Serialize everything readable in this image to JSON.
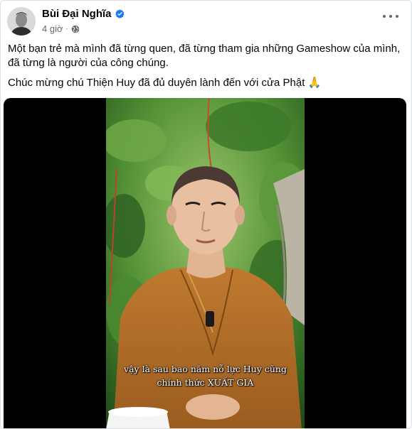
{
  "post": {
    "author": "Bùi Đại Nghĩa",
    "time": "4 giờ",
    "privacy_icon": "globe-icon",
    "verified_icon": "verified-badge-icon",
    "more_icon": "more-options-icon",
    "text_lines": [
      "Một bạn trẻ mà mình đã từng quen, đã từng tham gia những Gameshow của mình, đã từng là người của công chúng.",
      "Chúc mừng chú Thiện Huy đã đủ duyên lành đến với cửa Phật 🙏"
    ]
  },
  "video": {
    "subtitle_line1": "vậy là sau bao năm nỗ lực Huy cũng",
    "subtitle_line2": "chính thức XUẤT GIA"
  },
  "colors": {
    "verified": "#1877f2",
    "muted": "#65676b",
    "robe": "#b8752f"
  }
}
